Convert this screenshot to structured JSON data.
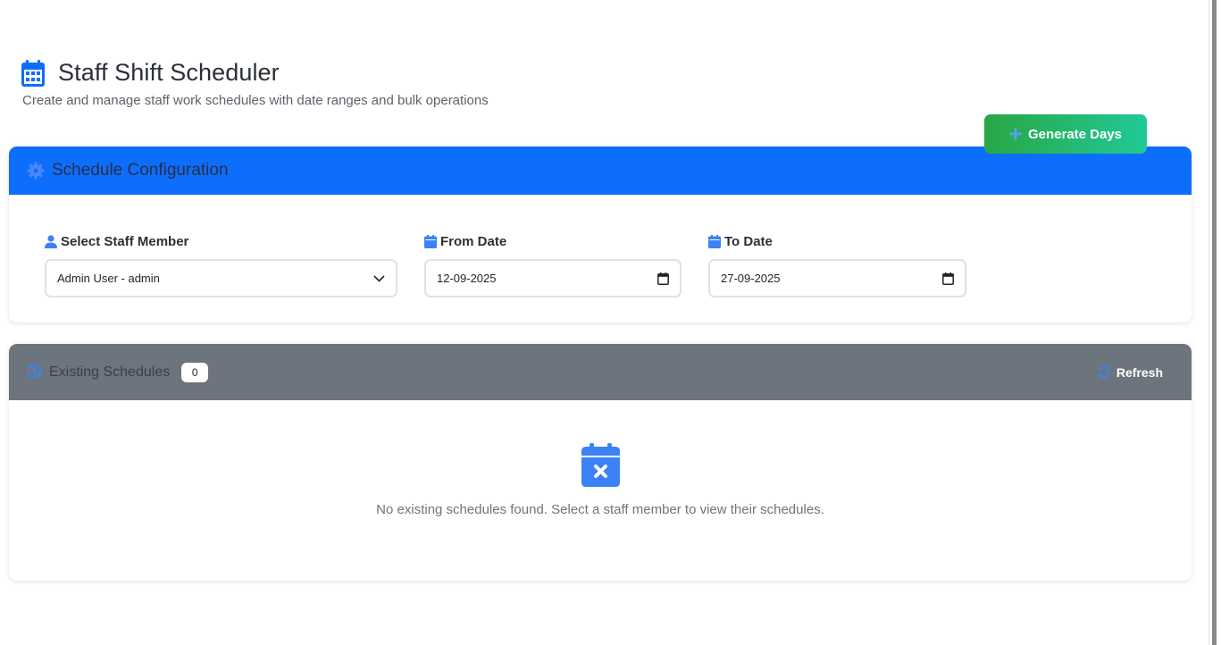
{
  "header": {
    "icon": "calendar-icon",
    "title": "Staff Shift Scheduler",
    "subtitle": "Create and manage staff work schedules with date ranges and bulk operations"
  },
  "config": {
    "icon": "gear-icon",
    "title": "Schedule Configuration",
    "staff": {
      "label": "Select Staff Member",
      "icon": "user-icon",
      "value": "Admin User - admin"
    },
    "from_date": {
      "label": "From Date",
      "icon": "calendar-icon",
      "value": "12-09-2025"
    },
    "to_date": {
      "label": "To Date",
      "icon": "calendar-icon",
      "value": "27-09-2025"
    },
    "generate_label": "Generate Days"
  },
  "existing": {
    "icon": "history-icon",
    "title": "Existing Schedules",
    "count": "0",
    "refresh_label": "Refresh",
    "empty_icon": "calendar-x-icon",
    "empty_text": "No existing schedules found. Select a staff member to view their schedules."
  },
  "colors": {
    "primary": "#0d6efd",
    "secondary": "#6c757d",
    "success_start": "#28a745",
    "success_end": "#20c997",
    "icon_blue": "#3b82f6"
  }
}
